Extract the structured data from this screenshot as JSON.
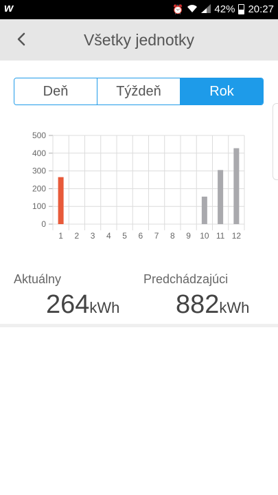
{
  "status_bar": {
    "app_icon": "wish-icon",
    "battery": "42%",
    "time": "20:27"
  },
  "header": {
    "title": "Všetky jednotky"
  },
  "tabs": [
    {
      "label": "Deň",
      "active": false
    },
    {
      "label": "Týždeň",
      "active": false
    },
    {
      "label": "Rok",
      "active": true
    }
  ],
  "colors": {
    "accent": "#1e9be9",
    "current_bar": "#e85a3a",
    "previous_bar": "#a9a9ad"
  },
  "chart_data": {
    "type": "bar",
    "categories": [
      "1",
      "2",
      "3",
      "4",
      "5",
      "6",
      "7",
      "8",
      "9",
      "10",
      "11",
      "12"
    ],
    "series": [
      {
        "values": [
          265,
          null,
          null,
          null,
          null,
          null,
          null,
          null,
          null,
          null,
          null,
          null
        ]
      },
      {
        "values": [
          null,
          null,
          null,
          null,
          null,
          null,
          null,
          null,
          null,
          155,
          305,
          428
        ]
      }
    ],
    "y_ticks": [
      0,
      100,
      200,
      300,
      400,
      500
    ],
    "ylim": [
      0,
      500
    ],
    "grid": true
  },
  "stats": {
    "current_label": "Aktuálny",
    "current_value": "264",
    "previous_label": "Predchádzajúci",
    "previous_value": "882",
    "unit": "kWh"
  }
}
